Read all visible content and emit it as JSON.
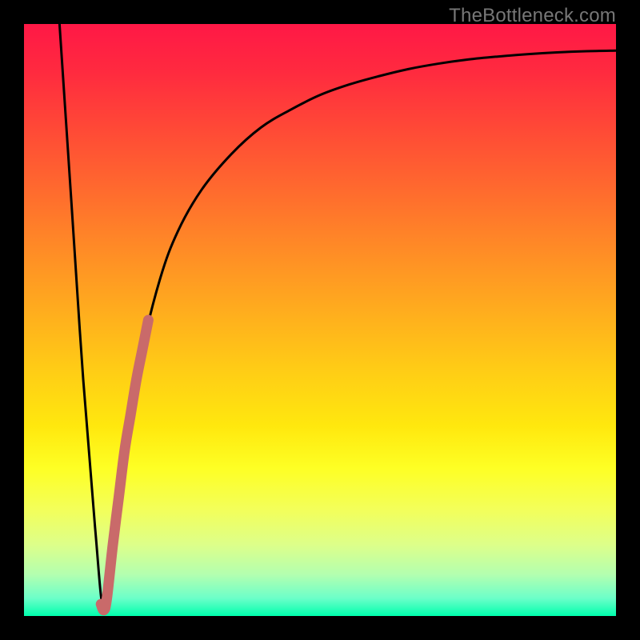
{
  "watermark": "TheBottleneck.com",
  "chart_data": {
    "type": "line",
    "title": "",
    "xlabel": "",
    "ylabel": "",
    "xlim": [
      0,
      100
    ],
    "ylim": [
      0,
      100
    ],
    "background_gradient": {
      "top": "#ff1846",
      "bottom": "#00ffad"
    },
    "series": [
      {
        "name": "primary-curve",
        "stroke": "#000000",
        "x": [
          6,
          8,
          10,
          12,
          13.5,
          15,
          17,
          20,
          23,
          26,
          30,
          35,
          40,
          45,
          50,
          55,
          60,
          65,
          70,
          75,
          80,
          85,
          90,
          95,
          100
        ],
        "y": [
          100,
          70,
          40,
          15,
          1,
          12,
          28,
          45,
          57,
          65,
          72,
          78,
          82.5,
          85.5,
          88,
          89.8,
          91.2,
          92.4,
          93.3,
          94,
          94.5,
          94.9,
          95.2,
          95.4,
          95.5
        ]
      },
      {
        "name": "highlight-segment",
        "stroke": "#c96a6a",
        "x": [
          13,
          13.5,
          14,
          15,
          16,
          17,
          18,
          19,
          20,
          21
        ],
        "y": [
          2,
          1,
          3,
          12,
          20,
          28,
          34,
          40,
          45,
          50
        ]
      }
    ]
  }
}
